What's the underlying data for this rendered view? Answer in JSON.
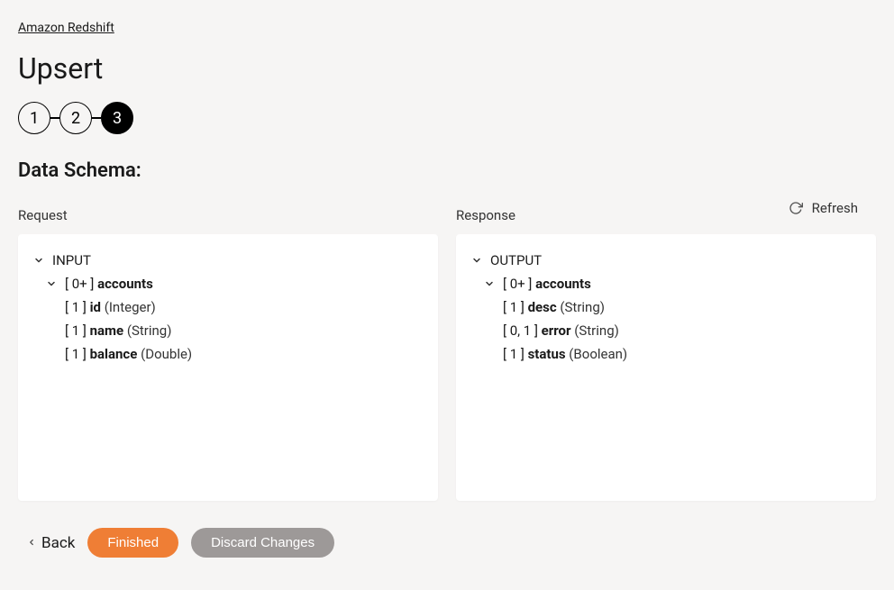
{
  "breadcrumb": "Amazon Redshift",
  "page_title": "Upsert",
  "stepper": {
    "steps": [
      "1",
      "2",
      "3"
    ],
    "active_index": 2
  },
  "section_title": "Data Schema:",
  "refresh_label": "Refresh",
  "request": {
    "title": "Request",
    "root_label": "INPUT",
    "items": {
      "cardinality": "[ 0+ ]",
      "name": "accounts",
      "fields": [
        {
          "cardinality": "[ 1 ]",
          "name": "id",
          "type": "(Integer)"
        },
        {
          "cardinality": "[ 1 ]",
          "name": "name",
          "type": "(String)"
        },
        {
          "cardinality": "[ 1 ]",
          "name": "balance",
          "type": "(Double)"
        }
      ]
    }
  },
  "response": {
    "title": "Response",
    "root_label": "OUTPUT",
    "items": {
      "cardinality": "[ 0+ ]",
      "name": "accounts",
      "fields": [
        {
          "cardinality": "[ 1 ]",
          "name": "desc",
          "type": "(String)"
        },
        {
          "cardinality": "[ 0, 1 ]",
          "name": "error",
          "type": "(String)"
        },
        {
          "cardinality": "[ 1 ]",
          "name": "status",
          "type": "(Boolean)"
        }
      ]
    }
  },
  "footer": {
    "back": "Back",
    "finished": "Finished",
    "discard": "Discard Changes"
  }
}
